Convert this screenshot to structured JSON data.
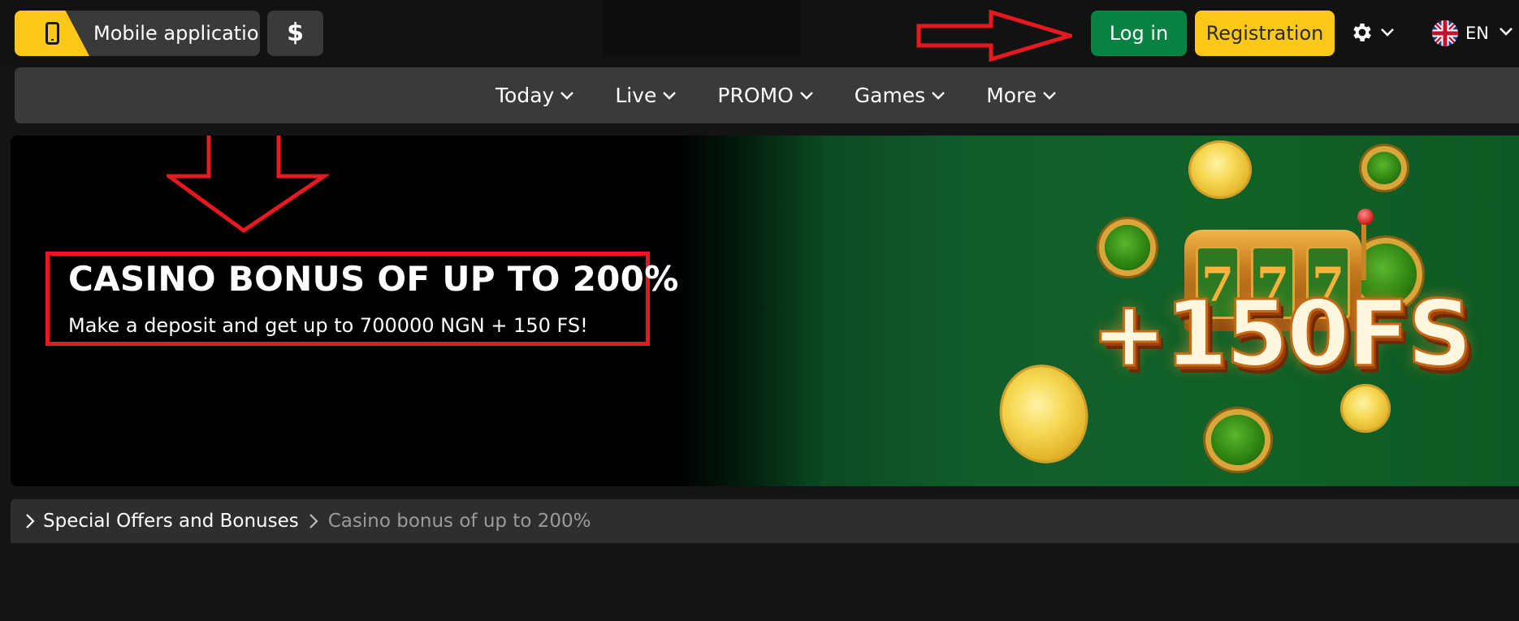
{
  "header": {
    "mobile_app_label": "Mobile application",
    "currency_symbol": "$",
    "login_label": "Log in",
    "registration_label": "Registration",
    "language_code": "EN",
    "colors": {
      "brand_yellow": "#fdc818",
      "login_green": "#078243",
      "annotation_red": "#e5191f"
    }
  },
  "nav": {
    "items": [
      {
        "label": "Today"
      },
      {
        "label": "Live"
      },
      {
        "label": "PROMO"
      },
      {
        "label": "Games"
      },
      {
        "label": "More"
      }
    ]
  },
  "banner": {
    "title": "CASINO BONUS OF UP TO 200%",
    "subtitle": "Make a deposit and get up to 700000 NGN + 150 FS!",
    "graphic_text": "+150FS",
    "reels": [
      "7",
      "7",
      "7"
    ]
  },
  "breadcrumb": {
    "parent": "Special Offers and Bonuses",
    "current": "Casino bonus of up to 200%"
  },
  "icons": {
    "phone": "phone-icon",
    "gear": "gear-icon",
    "flag": "uk-flag-icon",
    "chevron": "chevron-down-icon"
  }
}
